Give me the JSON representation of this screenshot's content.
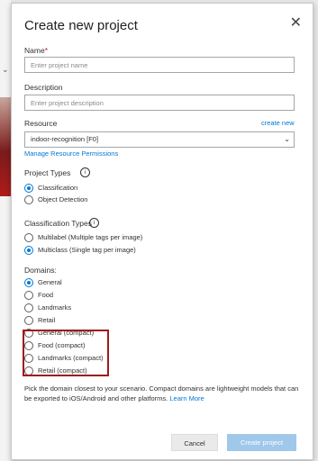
{
  "dialog": {
    "title": "Create new project",
    "close_icon": "close-icon"
  },
  "name": {
    "label": "Name",
    "required_mark": "*",
    "placeholder": "Enter project name",
    "value": ""
  },
  "description": {
    "label": "Description",
    "placeholder": "Enter project description",
    "value": ""
  },
  "resource": {
    "label": "Resource",
    "create_new_link": "create new",
    "selected": "indoor-recognition [F0]",
    "manage_link": "Manage Resource Permissions"
  },
  "project_types": {
    "label": "Project Types",
    "info_icon": "info-icon",
    "options": [
      {
        "label": "Classification",
        "checked": true
      },
      {
        "label": "Object Detection",
        "checked": false
      }
    ]
  },
  "classification_types": {
    "label": "Classification Types",
    "info_icon": "info-icon",
    "options": [
      {
        "label": "Multilabel (Multiple tags per image)",
        "checked": false
      },
      {
        "label": "Multiclass (Single tag per image)",
        "checked": true
      }
    ]
  },
  "domains": {
    "label": "Domains:",
    "options": [
      {
        "label": "General",
        "checked": true
      },
      {
        "label": "Food",
        "checked": false
      },
      {
        "label": "Landmarks",
        "checked": false
      },
      {
        "label": "Retail",
        "checked": false
      },
      {
        "label": "General (compact)",
        "checked": false
      },
      {
        "label": "Food (compact)",
        "checked": false
      },
      {
        "label": "Landmarks (compact)",
        "checked": false
      },
      {
        "label": "Retail (compact)",
        "checked": false
      }
    ]
  },
  "help": {
    "text": "Pick the domain closest to your scenario. Compact domains are lightweight models that can be exported to iOS/Android and other platforms.",
    "link": "Learn More"
  },
  "buttons": {
    "cancel": "Cancel",
    "create": "Create project"
  },
  "colors": {
    "accent": "#0078d4",
    "highlight_border": "#9e1b1b",
    "create_disabled": "#9fc8ea"
  }
}
